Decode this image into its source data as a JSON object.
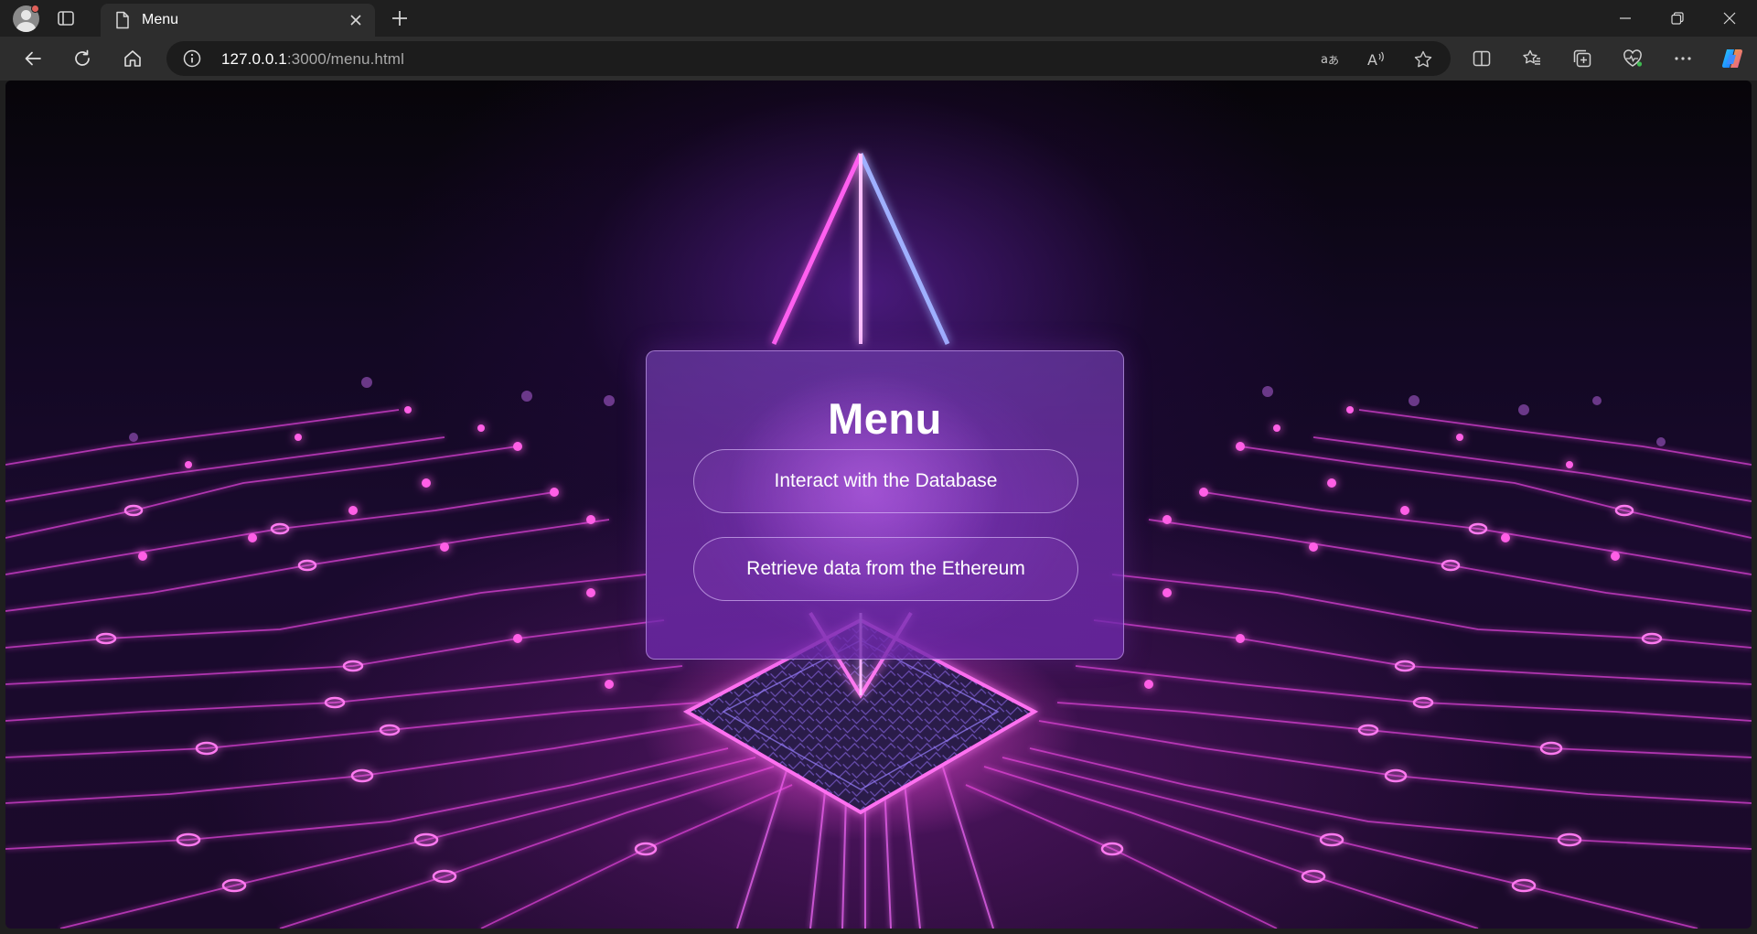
{
  "browser": {
    "tab": {
      "title": "Menu"
    },
    "address": {
      "host": "127.0.0.1",
      "rest": ":3000/menu.html"
    }
  },
  "page": {
    "title": "Menu",
    "buttons": {
      "database": "Interact with the Database",
      "ethereum": "Retrieve data from the Ethereum"
    }
  },
  "colors": {
    "chrome_bg": "#1f1f1f",
    "toolbar_bg": "#2d2d2d",
    "neon_pink": "#ff3fd8",
    "neon_purple": "#9b4dff"
  }
}
